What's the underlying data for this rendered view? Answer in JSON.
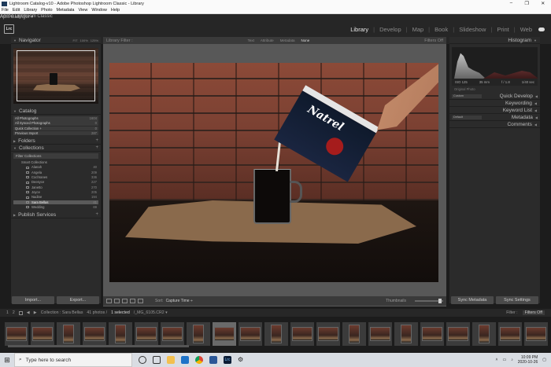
{
  "window": {
    "title": "Lightroom Catalog-v10 - Adobe Photoshop Lightroom Classic - Library",
    "controls": [
      "–",
      "❐",
      "✕"
    ]
  },
  "menu": [
    "File",
    "Edit",
    "Library",
    "Photo",
    "Metadata",
    "View",
    "Window",
    "Help"
  ],
  "identity": {
    "logo": "Lrc",
    "app_name": "Adobe Lightroom Classic",
    "user": "April Gallinger ▾"
  },
  "modules": {
    "library": "Library",
    "develop": "Develop",
    "map": "Map",
    "book": "Book",
    "slideshow": "Slideshow",
    "print": "Print",
    "web": "Web",
    "active": "Library"
  },
  "left": {
    "navigator": {
      "title": "Navigator",
      "opts": [
        "FIT",
        "100%",
        "125%"
      ]
    },
    "catalog": {
      "title": "Catalog",
      "rows": [
        {
          "label": "All Photographs",
          "count": "1604"
        },
        {
          "label": "All Synced Photographs",
          "count": "0"
        },
        {
          "label": "Quick Collection +",
          "count": "0"
        },
        {
          "label": "Previous Import",
          "count": "287"
        }
      ]
    },
    "folders": {
      "title": "Folders"
    },
    "collections": {
      "title": "Collections",
      "filter": "Filter Collections",
      "group": "Smart Collections",
      "items": [
        {
          "label": "Alanah",
          "count": "40"
        },
        {
          "label": "Angela",
          "count": "209"
        },
        {
          "label": "Cochranes",
          "count": "336"
        },
        {
          "label": "Deesyce",
          "count": "227"
        },
        {
          "label": "Janetto",
          "count": "270"
        },
        {
          "label": "Joyce",
          "count": "205"
        },
        {
          "label": "Nadine",
          "count": "194"
        },
        {
          "label": "Sara Bellas",
          "count": "41"
        },
        {
          "label": "Wedding",
          "count": "69"
        }
      ]
    },
    "publish": {
      "title": "Publish Services"
    },
    "import_label": "Import...",
    "export_label": "Export..."
  },
  "center": {
    "filter_bar": {
      "title": "Library Filter :",
      "opts": [
        "Text",
        "Attribute",
        "Metadata",
        "None"
      ],
      "active": "None",
      "right": "Filters Off"
    },
    "photo_brand": "Natrel",
    "toolbar": {
      "sort_label": "Sort:",
      "sort_value": "Capture Time ÷",
      "thumb_label": "Thumbnails"
    }
  },
  "right": {
    "histogram": {
      "title": "Histogram"
    },
    "exif": [
      "ISO 125",
      "35 mm",
      "f / 1.8",
      "1/40 sec"
    ],
    "original": "Original Photo",
    "quick_develop": {
      "preset": "Custom",
      "title": "Quick Develop"
    },
    "keywording": "Keywording",
    "keyword_list": "Keyword List",
    "metadata": {
      "preset": "Default",
      "title": "Metadata"
    },
    "comments": "Comments",
    "sync_meta_label": "Sync Metadata",
    "sync_settings_label": "Sync Settings"
  },
  "filmstrip_bar": {
    "one": "1",
    "two": "2",
    "source": "Collection : Sara Bellas",
    "count": "41 photos /",
    "selected": "1 selected",
    "file": "/_MG_6105.CR2 ▾",
    "filter_label": "Filter :",
    "filter_value": "Filters Off"
  },
  "taskbar": {
    "search_placeholder": "Type here to search",
    "time": "10:09 PM",
    "date": "2020-10-26"
  }
}
